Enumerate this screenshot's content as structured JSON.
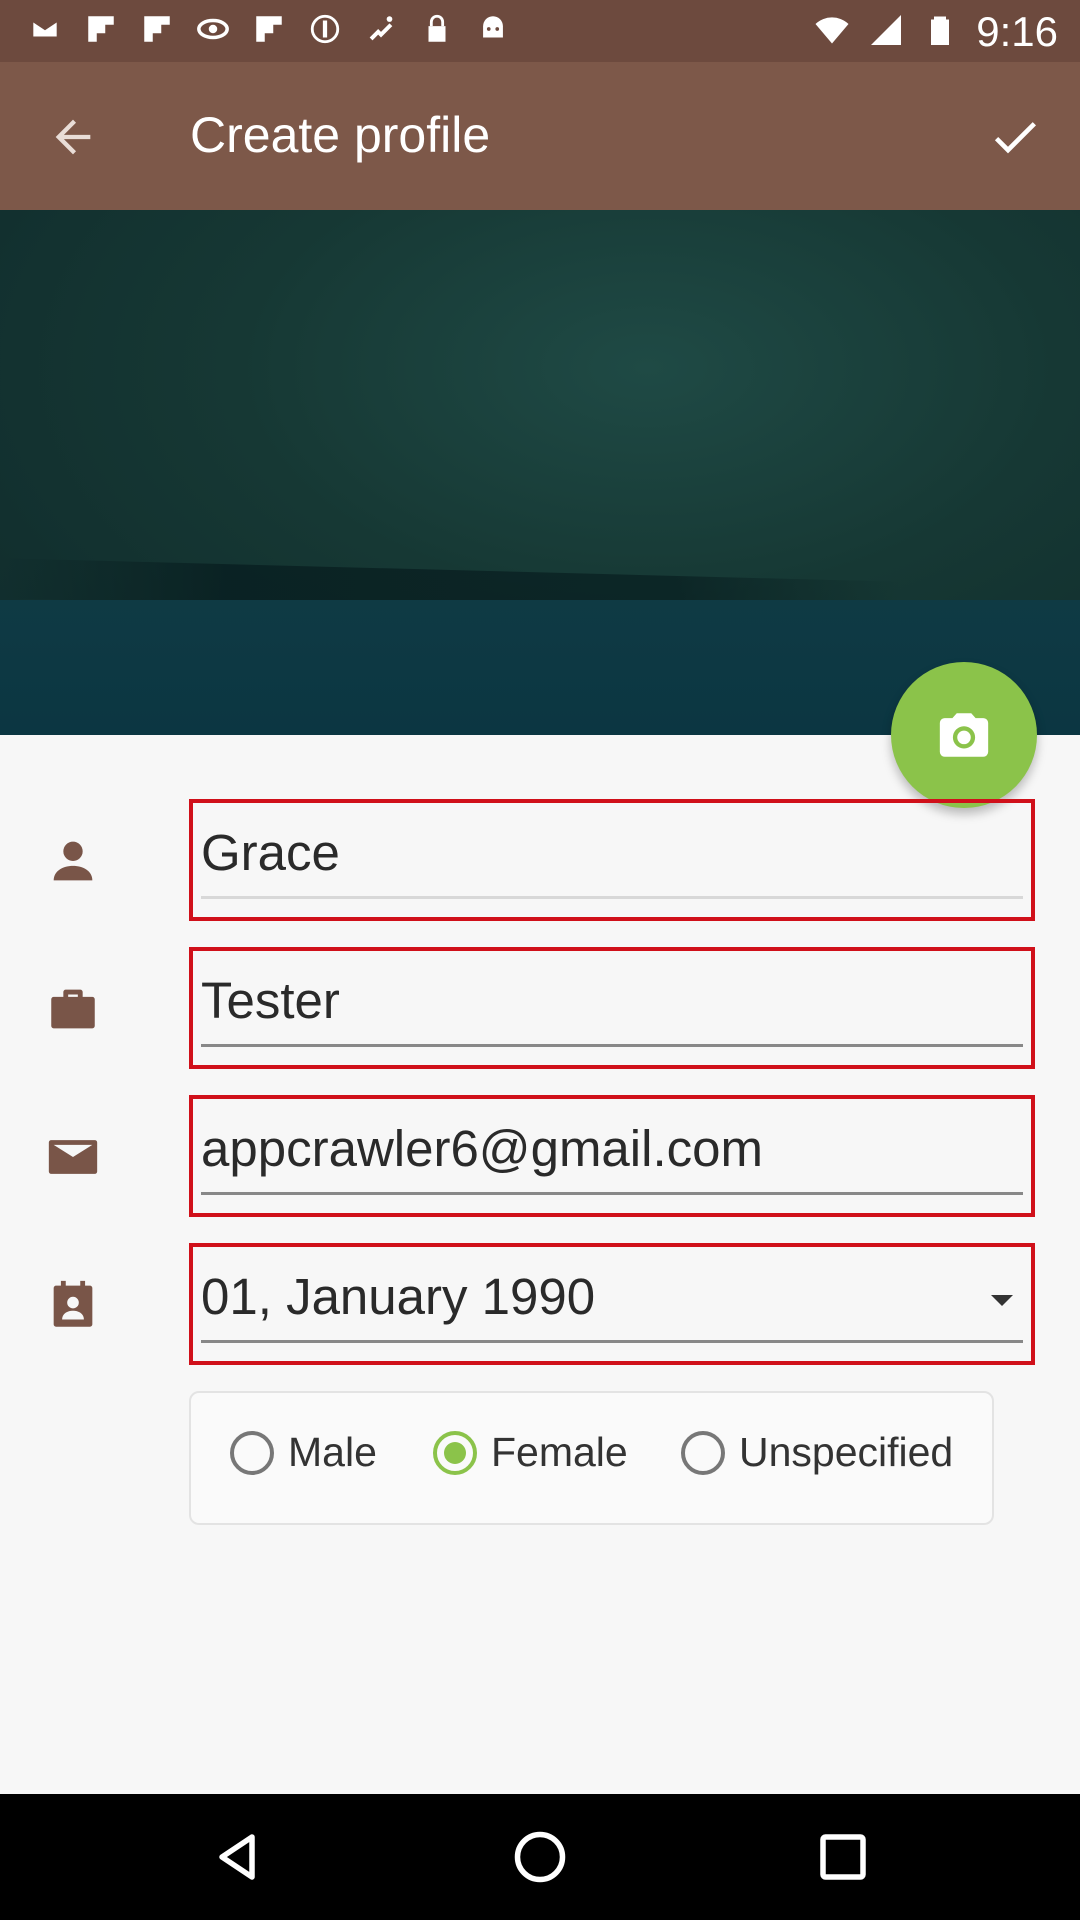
{
  "status_bar": {
    "time": "9:16",
    "icons": [
      "mail-icon",
      "flipboard-icon",
      "flipboard-icon",
      "nvidia-icon",
      "flipboard-icon",
      "notification-icon",
      "fake-gps-icon",
      "lock-icon",
      "android-icon"
    ]
  },
  "app_bar": {
    "title": "Create profile",
    "back_icon": "arrow-back-icon",
    "confirm_icon": "check-icon",
    "background": "#7d5849"
  },
  "form": {
    "name": {
      "value": "Grace",
      "icon": "person-icon"
    },
    "occupation": {
      "value": "Tester",
      "icon": "briefcase-icon"
    },
    "email": {
      "value": "appcrawler6@gmail.com",
      "icon": "email-icon"
    },
    "birthday": {
      "value": "01, January 1990",
      "icon": "contact-calendar-icon"
    },
    "gender": {
      "options": [
        "Male",
        "Female",
        "Unspecified"
      ],
      "selected": "Female"
    }
  },
  "colors": {
    "accent": "#8bc34a",
    "highlight_border": "#d0101a",
    "icon": "#795548"
  }
}
